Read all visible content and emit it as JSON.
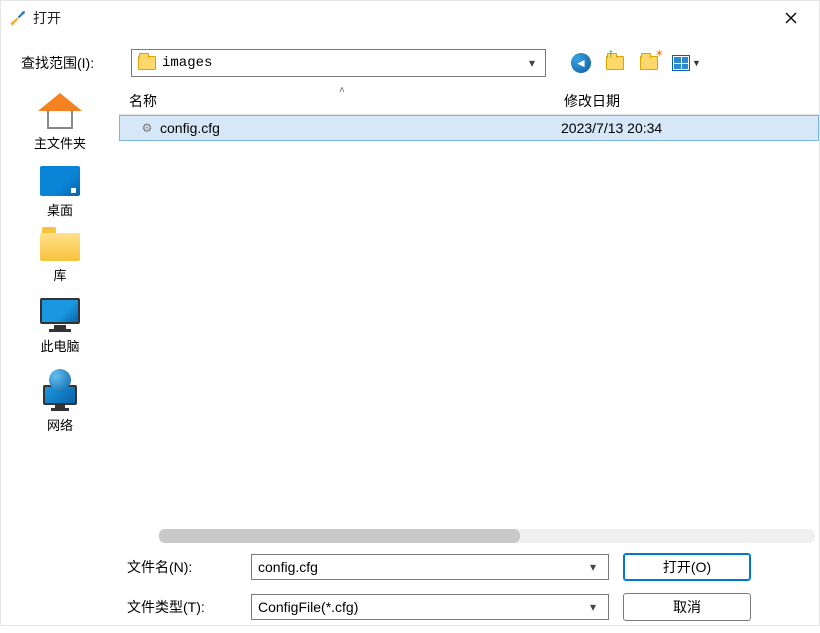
{
  "window": {
    "title": "打开"
  },
  "lookin": {
    "label": "查找范围(I):",
    "value": "images"
  },
  "columns": {
    "name": "名称",
    "date": "修改日期"
  },
  "files": [
    {
      "name": "config.cfg",
      "date": "2023/7/13 20:34"
    }
  ],
  "filename": {
    "label": "文件名(N):",
    "value": "config.cfg"
  },
  "filetype": {
    "label": "文件类型(T):",
    "value": "ConfigFile(*.cfg)"
  },
  "buttons": {
    "open": "打开(O)",
    "cancel": "取消"
  },
  "places": {
    "home": "主文件夹",
    "desktop": "桌面",
    "library": "库",
    "thispc": "此电脑",
    "network": "网络"
  }
}
